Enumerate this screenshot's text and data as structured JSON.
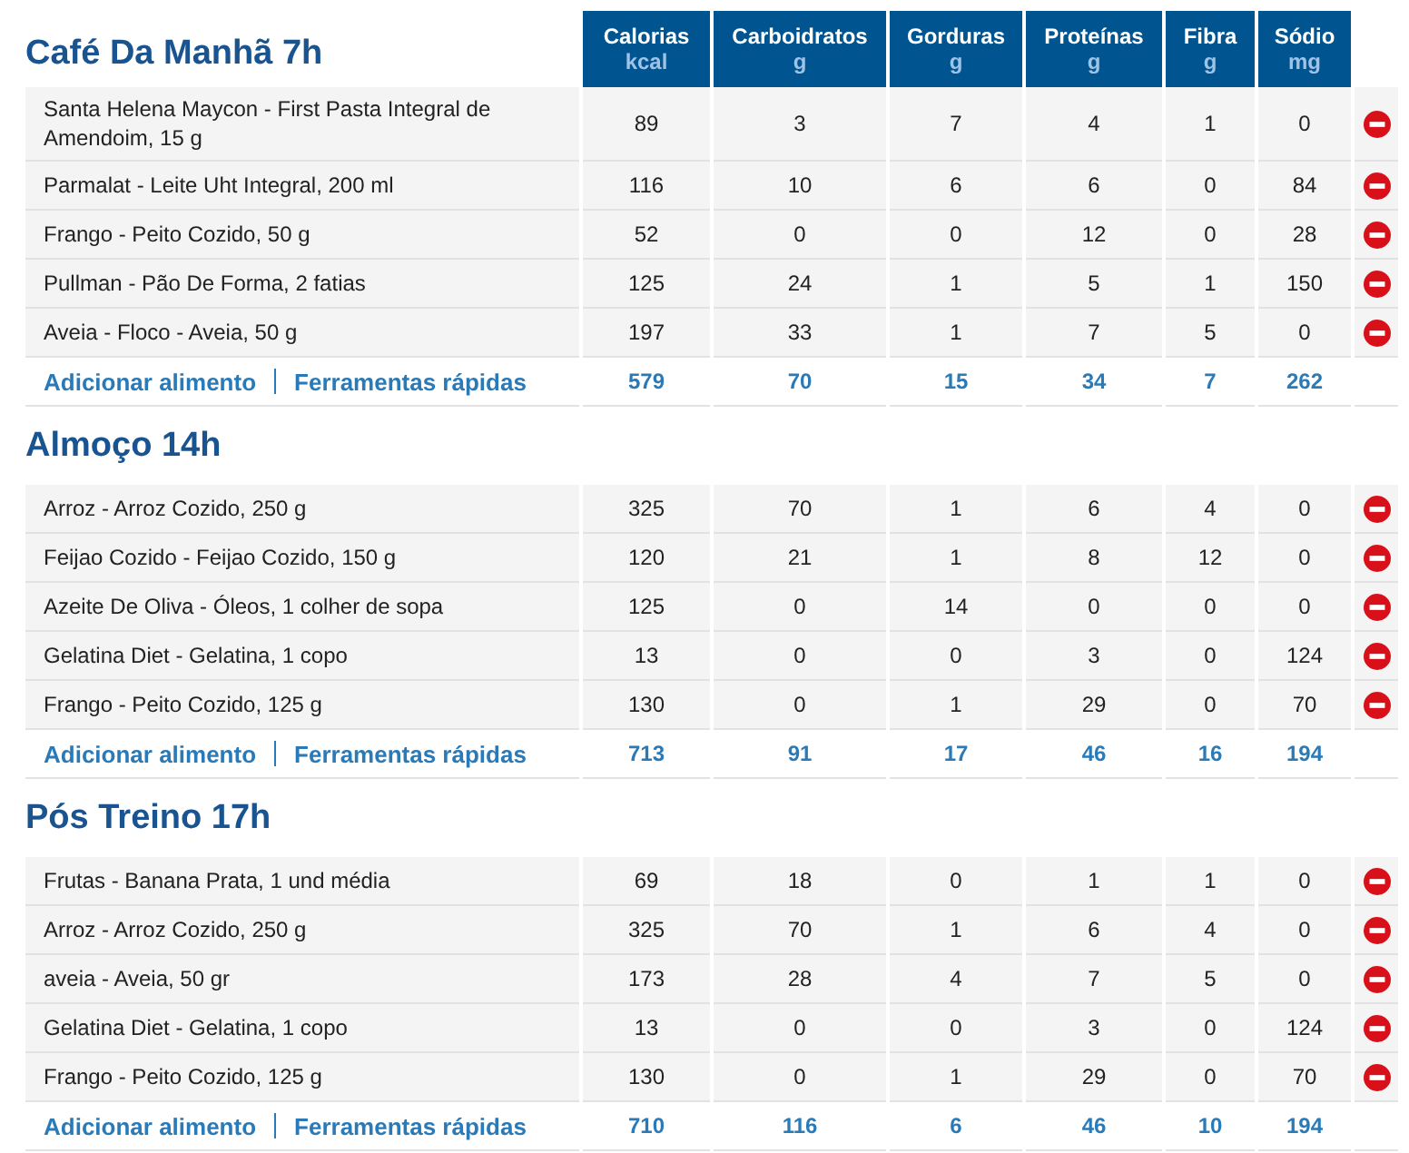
{
  "sections": [
    {
      "title": "Café Da Manhã 7h",
      "columns": [
        {
          "label": "Calorias",
          "unit": "kcal"
        },
        {
          "label": "Carboidratos",
          "unit": "g"
        },
        {
          "label": "Gorduras",
          "unit": "g"
        },
        {
          "label": "Proteínas",
          "unit": "g"
        },
        {
          "label": "Fibra",
          "unit": "g"
        },
        {
          "label": "Sódio",
          "unit": "mg"
        }
      ],
      "rows": [
        {
          "food": "Santa Helena Maycon - First Pasta Integral de Amendoim, 15 g",
          "values": [
            "89",
            "3",
            "7",
            "4",
            "1",
            "0"
          ]
        },
        {
          "food": "Parmalat - Leite Uht Integral, 200 ml",
          "values": [
            "116",
            "10",
            "6",
            "6",
            "0",
            "84"
          ]
        },
        {
          "food": "Frango - Peito Cozido, 50 g",
          "values": [
            "52",
            "0",
            "0",
            "12",
            "0",
            "28"
          ]
        },
        {
          "food": "Pullman - Pão De Forma, 2 fatias",
          "values": [
            "125",
            "24",
            "1",
            "5",
            "1",
            "150"
          ]
        },
        {
          "food": "Aveia - Floco - Aveia, 50 g",
          "values": [
            "197",
            "33",
            "1",
            "7",
            "5",
            "0"
          ]
        }
      ],
      "links": [
        "Adicionar alimento",
        "Ferramentas rápidas"
      ],
      "totals": [
        "579",
        "70",
        "15",
        "34",
        "7",
        "262"
      ]
    },
    {
      "title": "Almoço 14h",
      "rows": [
        {
          "food": "Arroz - Arroz Cozido, 250 g",
          "values": [
            "325",
            "70",
            "1",
            "6",
            "4",
            "0"
          ]
        },
        {
          "food": "Feijao Cozido - Feijao Cozido, 150 g",
          "values": [
            "120",
            "21",
            "1",
            "8",
            "12",
            "0"
          ]
        },
        {
          "food": "Azeite De Oliva - Óleos, 1 colher de sopa",
          "values": [
            "125",
            "0",
            "14",
            "0",
            "0",
            "0"
          ]
        },
        {
          "food": "Gelatina Diet - Gelatina, 1 copo",
          "values": [
            "13",
            "0",
            "0",
            "3",
            "0",
            "124"
          ]
        },
        {
          "food": "Frango - Peito Cozido, 125 g",
          "values": [
            "130",
            "0",
            "1",
            "29",
            "0",
            "70"
          ]
        }
      ],
      "links": [
        "Adicionar alimento",
        "Ferramentas rápidas"
      ],
      "totals": [
        "713",
        "91",
        "17",
        "46",
        "16",
        "194"
      ]
    },
    {
      "title": "Pós Treino 17h",
      "rows": [
        {
          "food": "Frutas - Banana Prata, 1 und média",
          "values": [
            "69",
            "18",
            "0",
            "1",
            "1",
            "0"
          ]
        },
        {
          "food": "Arroz - Arroz Cozido, 250 g",
          "values": [
            "325",
            "70",
            "1",
            "6",
            "4",
            "0"
          ]
        },
        {
          "food": "aveia - Aveia, 50 gr",
          "values": [
            "173",
            "28",
            "4",
            "7",
            "5",
            "0"
          ]
        },
        {
          "food": "Gelatina Diet - Gelatina, 1 copo",
          "values": [
            "13",
            "0",
            "0",
            "3",
            "0",
            "124"
          ]
        },
        {
          "food": "Frango - Peito Cozido, 125 g",
          "values": [
            "130",
            "0",
            "1",
            "29",
            "0",
            "70"
          ]
        }
      ],
      "links": [
        "Adicionar alimento",
        "Ferramentas rápidas"
      ],
      "totals": [
        "710",
        "116",
        "6",
        "46",
        "10",
        "194"
      ]
    }
  ]
}
